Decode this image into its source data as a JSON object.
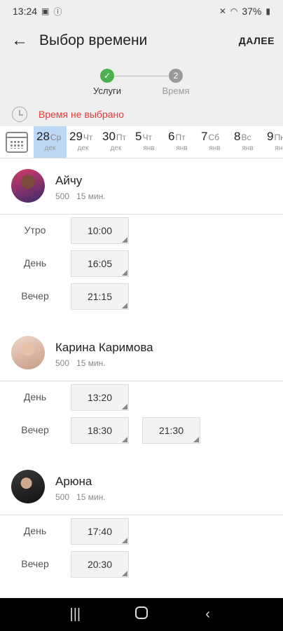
{
  "status_bar": {
    "time": "13:24",
    "battery": "37%"
  },
  "header": {
    "title": "Выбор времени",
    "next_label": "ДАЛЕЕ"
  },
  "stepper": {
    "steps": [
      {
        "label": "Услуги",
        "marker": "✓"
      },
      {
        "label": "Время",
        "marker": "2"
      }
    ]
  },
  "notice": {
    "text": "Время не выбрано"
  },
  "dates": [
    {
      "num": "28",
      "dow": "Ср",
      "mon": "дек"
    },
    {
      "num": "29",
      "dow": "Чт",
      "mon": "дек"
    },
    {
      "num": "30",
      "dow": "Пт",
      "mon": "дек"
    },
    {
      "num": "5",
      "dow": "Чт",
      "mon": "янв"
    },
    {
      "num": "6",
      "dow": "Пт",
      "mon": "янв"
    },
    {
      "num": "7",
      "dow": "Сб",
      "mon": "янв"
    },
    {
      "num": "8",
      "dow": "Вс",
      "mon": "янв"
    },
    {
      "num": "9",
      "dow": "Пн",
      "mon": "янв"
    }
  ],
  "masters": [
    {
      "name": "Айчу",
      "price": "500",
      "duration": "15 мин.",
      "periods": [
        {
          "label": "Утро",
          "slots": [
            "10:00"
          ]
        },
        {
          "label": "День",
          "slots": [
            "16:05"
          ]
        },
        {
          "label": "Вечер",
          "slots": [
            "21:15"
          ]
        }
      ]
    },
    {
      "name": "Карина Каримова",
      "price": "500",
      "duration": "15 мин.",
      "periods": [
        {
          "label": "День",
          "slots": [
            "13:20"
          ]
        },
        {
          "label": "Вечер",
          "slots": [
            "18:30",
            "21:30"
          ]
        }
      ]
    },
    {
      "name": "Арюна",
      "price": "500",
      "duration": "15 мин.",
      "periods": [
        {
          "label": "День",
          "slots": [
            "17:40"
          ]
        },
        {
          "label": "Вечер",
          "slots": [
            "20:30"
          ]
        }
      ]
    }
  ],
  "colors": {
    "accent_selected": "#bcd8f5",
    "warning": "#e53935",
    "done": "#4caf50"
  }
}
